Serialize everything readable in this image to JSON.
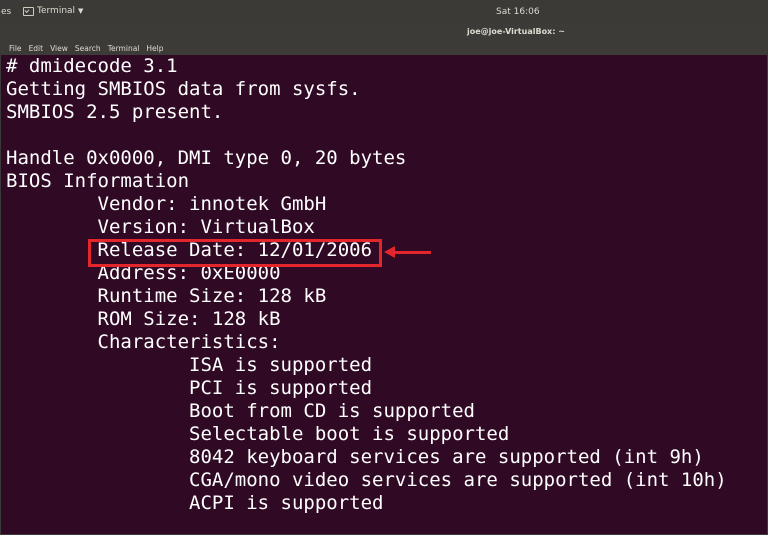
{
  "topbar": {
    "activities": "es",
    "app_menu_label": "Terminal",
    "clock": "Sat 16:06"
  },
  "window": {
    "title": "joe@joe-VirtualBox: ~"
  },
  "menubar": {
    "items": [
      "File",
      "Edit",
      "View",
      "Search",
      "Terminal",
      "Help"
    ]
  },
  "terminal": {
    "lines": [
      "# dmidecode 3.1",
      "Getting SMBIOS data from sysfs.",
      "SMBIOS 2.5 present.",
      "",
      "Handle 0x0000, DMI type 0, 20 bytes",
      "BIOS Information",
      "        Vendor: innotek GmbH",
      "        Version: VirtualBox",
      "        Release Date: 12/01/2006",
      "        Address: 0xE0000",
      "        Runtime Size: 128 kB",
      "        ROM Size: 128 kB",
      "        Characteristics:",
      "                ISA is supported",
      "                PCI is supported",
      "                Boot from CD is supported",
      "                Selectable boot is supported",
      "                8042 keyboard services are supported (int 9h)",
      "                CGA/mono video services are supported (int 10h)",
      "                ACPI is supported"
    ]
  },
  "annotation": {
    "color": "#e2262b",
    "highlighted_line": "Release Date: 12/01/2006"
  }
}
